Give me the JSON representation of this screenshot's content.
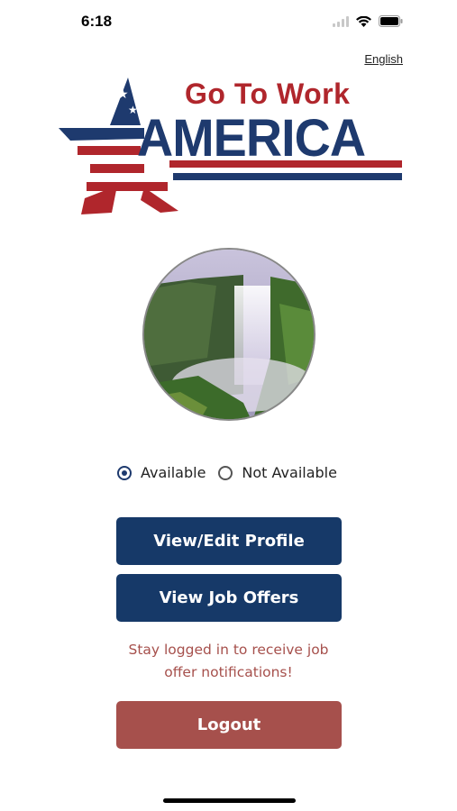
{
  "status_bar": {
    "time": "6:18",
    "icons": [
      "signal-icon",
      "wifi-icon",
      "battery-icon"
    ]
  },
  "header": {
    "language_link": "English"
  },
  "logo": {
    "line1": "Go To Work",
    "line2": "AMERICA",
    "colors": {
      "red": "#b0262c",
      "blue": "#1e3a6e"
    }
  },
  "profile": {
    "avatar": "waterfall-photo"
  },
  "availability": {
    "options": [
      {
        "label": "Available",
        "selected": true
      },
      {
        "label": "Not Available",
        "selected": false
      }
    ]
  },
  "buttons": {
    "profile_label": "View/Edit Profile",
    "offers_label": "View Job Offers",
    "logout_label": "Logout"
  },
  "notice": {
    "line1": "Stay logged in to receive job",
    "line2": "offer notifications!"
  },
  "theme": {
    "primary": "#163968",
    "logout": "#a6504c",
    "notice_text": "#a6504c"
  }
}
